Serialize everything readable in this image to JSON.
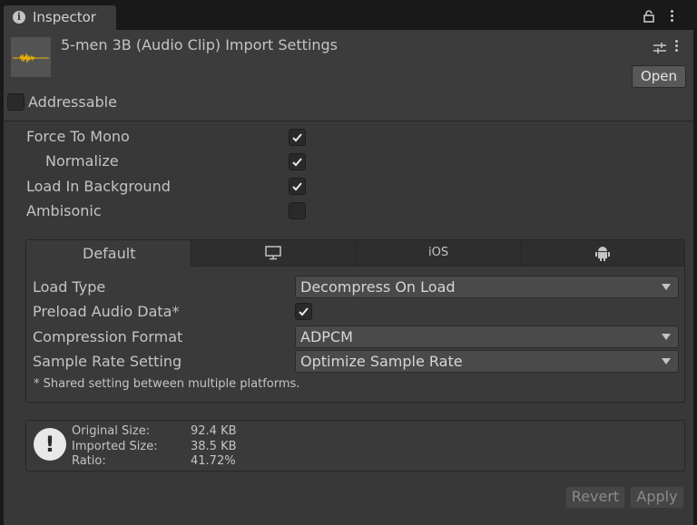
{
  "tab": {
    "label": "Inspector",
    "icon": "info-icon"
  },
  "header": {
    "title": "5-men 3B (Audio Clip) Import Settings",
    "open_label": "Open"
  },
  "addressable": {
    "label": "Addressable",
    "checked": false
  },
  "settings": [
    {
      "label": "Force To Mono",
      "checked": true
    },
    {
      "label": "Normalize",
      "checked": true
    },
    {
      "label": "Load In Background",
      "checked": true
    },
    {
      "label": "Ambisonic",
      "checked": false
    }
  ],
  "platform_tabs": {
    "default": "Default",
    "standalone": "desktop-icon",
    "ios": "iOS",
    "android": "android-icon"
  },
  "platform_settings": {
    "load_type": {
      "label": "Load Type",
      "value": "Decompress On Load"
    },
    "preload": {
      "label": "Preload Audio Data*",
      "checked": true
    },
    "compression": {
      "label": "Compression Format",
      "value": "ADPCM"
    },
    "sample_rate": {
      "label": "Sample Rate Setting",
      "value": "Optimize Sample Rate"
    },
    "note": "* Shared setting between multiple platforms."
  },
  "info": {
    "original_label": "Original Size:",
    "original_value": "92.4 KB",
    "imported_label": "Imported Size:",
    "imported_value": "38.5 KB",
    "ratio_label": "Ratio:",
    "ratio_value": "41.72%"
  },
  "footer": {
    "revert": "Revert",
    "apply": "Apply"
  },
  "colors": {
    "panel": "#383838",
    "header": "#3c3c3c",
    "waveform": "#f0b400"
  }
}
